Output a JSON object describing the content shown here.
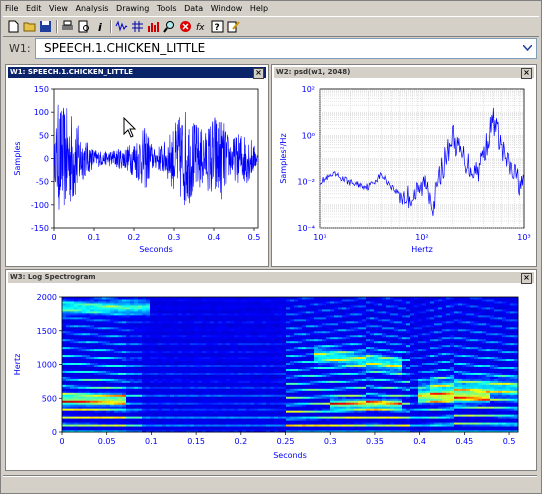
{
  "menu": [
    "File",
    "Edit",
    "View",
    "Analysis",
    "Drawing",
    "Tools",
    "Data",
    "Window",
    "Help"
  ],
  "toolbar": {
    "icons": [
      "new-file-icon",
      "open-folder-icon",
      "save-icon",
      "print-icon",
      "print-preview-icon",
      "info-icon",
      "waveform-icon",
      "grid-icon",
      "bar-chart-icon",
      "zoom-icon",
      "stop-icon",
      "function-icon",
      "help-icon",
      "edit-icon"
    ]
  },
  "window_selector": {
    "label": "W1:",
    "value": "SPEECH.1.CHICKEN_LITTLE"
  },
  "w1": {
    "title": "W1: SPEECH.1.CHICKEN_LITTLE",
    "chart_data": {
      "type": "line",
      "title": "",
      "xlabel": "Seconds",
      "ylabel": "Samples",
      "xlim": [
        0,
        0.51
      ],
      "ylim": [
        -150,
        150
      ],
      "xticks": [
        "0",
        "0.1",
        "0.2",
        "0.3",
        "0.4",
        "0.5"
      ],
      "yticks": [
        "150",
        "100",
        "50",
        "0",
        "-50",
        "-100",
        "-150"
      ],
      "series": [
        {
          "color": "#0000ff",
          "envelope": [
            [
              0,
              20
            ],
            [
              0.01,
              120
            ],
            [
              0.03,
              110
            ],
            [
              0.05,
              100
            ],
            [
              0.07,
              50
            ],
            [
              0.1,
              20
            ],
            [
              0.13,
              15
            ],
            [
              0.15,
              20
            ],
            [
              0.18,
              25
            ],
            [
              0.2,
              40
            ],
            [
              0.23,
              70
            ],
            [
              0.25,
              20
            ],
            [
              0.28,
              40
            ],
            [
              0.31,
              90
            ],
            [
              0.33,
              110
            ],
            [
              0.35,
              80
            ],
            [
              0.38,
              60
            ],
            [
              0.4,
              100
            ],
            [
              0.42,
              90
            ],
            [
              0.44,
              40
            ],
            [
              0.47,
              60
            ],
            [
              0.49,
              50
            ],
            [
              0.51,
              10
            ]
          ]
        }
      ]
    }
  },
  "w2": {
    "title": "W2: psd(w1, 2048)",
    "chart_data": {
      "type": "line",
      "title": "",
      "xlabel": "Hertz",
      "ylabel": "Samples²/Hz",
      "xscale": "log",
      "yscale": "log",
      "xlim": [
        10,
        1000
      ],
      "ylim": [
        0.0001,
        100
      ],
      "xticks": [
        "10¹",
        "10²",
        "10³"
      ],
      "yticks": [
        "10²",
        "10⁰",
        "10⁻²",
        "10⁻⁴"
      ],
      "series": [
        {
          "color": "#0000ff",
          "points": [
            [
              10,
              0.01
            ],
            [
              14,
              0.02
            ],
            [
              20,
              0.009
            ],
            [
              30,
              0.006
            ],
            [
              40,
              0.02
            ],
            [
              55,
              0.004
            ],
            [
              70,
              0.002
            ],
            [
              90,
              0.003
            ],
            [
              110,
              0.01
            ],
            [
              130,
              0.001
            ],
            [
              150,
              0.02
            ],
            [
              170,
              0.1
            ],
            [
              200,
              1
            ],
            [
              230,
              0.2
            ],
            [
              260,
              0.1
            ],
            [
              300,
              0.04
            ],
            [
              350,
              0.03
            ],
            [
              420,
              0.3
            ],
            [
              500,
              5
            ],
            [
              560,
              1
            ],
            [
              620,
              0.2
            ],
            [
              700,
              0.05
            ],
            [
              800,
              0.02
            ],
            [
              900,
              0.01
            ],
            [
              1000,
              0.006
            ]
          ]
        }
      ]
    }
  },
  "w3": {
    "title": "W3: Log Spectrogram",
    "chart_data": {
      "type": "heatmap",
      "title": "",
      "xlabel": "Seconds",
      "ylabel": "Hertz",
      "xlim": [
        0,
        0.51
      ],
      "ylim": [
        0,
        2000
      ],
      "xticks": [
        "0",
        "0.05",
        "0.1",
        "0.15",
        "0.2",
        "0.25",
        "0.3",
        "0.35",
        "0.4",
        "0.45",
        "0.5"
      ],
      "yticks": [
        "2000",
        "1500",
        "1000",
        "500",
        "0"
      ],
      "colormap": [
        "#00008f",
        "#0000ff",
        "#00ffff",
        "#ffff00",
        "#ff0000",
        "#800000"
      ]
    }
  },
  "colors": {
    "titlebar_active": "#0a246a",
    "plot_line": "#0000ff",
    "axis_text": "#0000ff"
  }
}
